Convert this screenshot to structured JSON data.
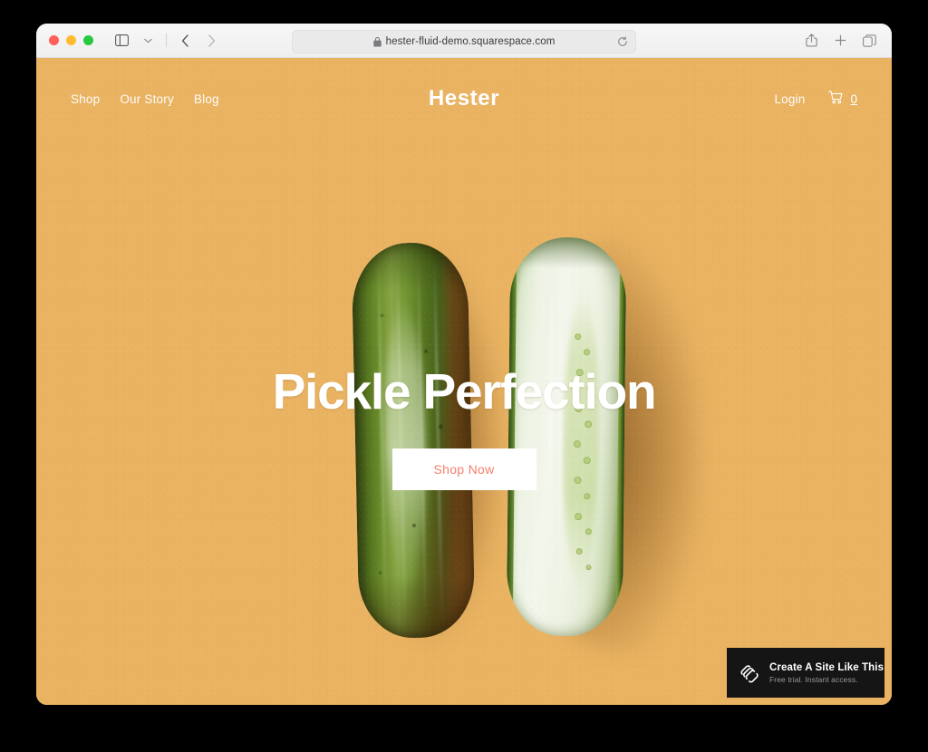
{
  "browser": {
    "traffic_lights": [
      "close",
      "minimize",
      "zoom"
    ],
    "sidebar_toggle_icon": "sidebar-icon",
    "tab_overview_icon": "chevron-down-icon",
    "back_icon": "chevron-left-icon",
    "forward_icon": "chevron-right-icon",
    "address": {
      "lock_icon": "lock-icon",
      "url": "hester-fluid-demo.squarespace.com",
      "reload_icon": "reload-icon"
    },
    "share_icon": "share-icon",
    "new_tab_icon": "plus-icon",
    "tabs_icon": "tabs-icon"
  },
  "site": {
    "brand": "Hester",
    "nav_left": [
      {
        "label": "Shop"
      },
      {
        "label": "Our Story"
      },
      {
        "label": "Blog"
      }
    ],
    "nav_right": {
      "login_label": "Login",
      "cart_icon": "cart-icon",
      "cart_count": "0"
    },
    "hero": {
      "title": "Pickle Perfection",
      "cta_label": "Shop Now",
      "background_color": "#e9b362",
      "cta_text_color": "#f4806c",
      "cta_background_color": "#ffffff",
      "image_alt": "whole cucumber beside a halved cucumber on an amber background"
    },
    "badge": {
      "logo_icon": "squarespace-logo-icon",
      "title": "Create A Site Like This",
      "subtitle": "Free trial. Instant access.",
      "background_color": "#151515"
    }
  }
}
